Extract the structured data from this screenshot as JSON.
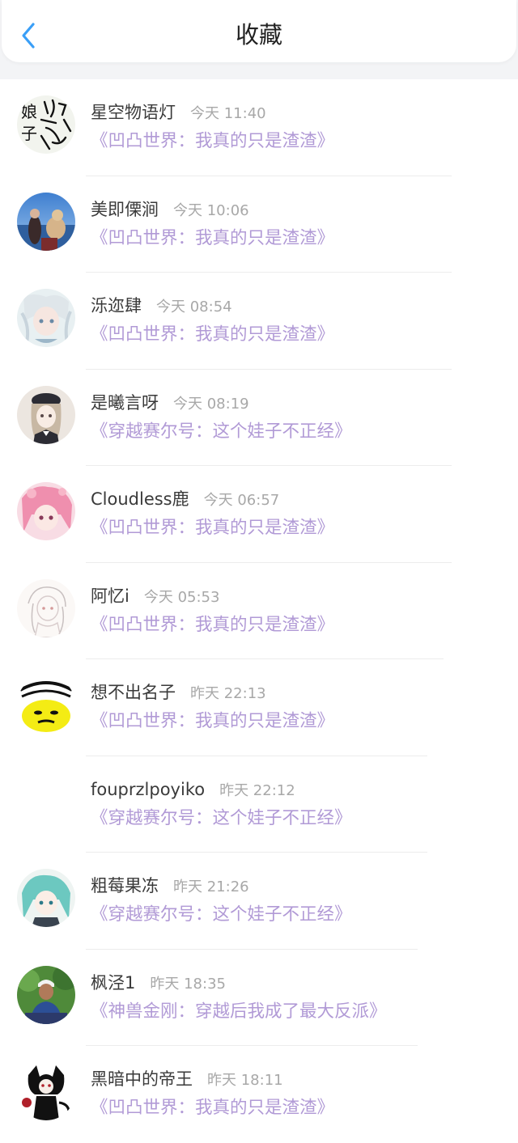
{
  "header": {
    "title": "收藏",
    "back_icon": "chevron-left-icon",
    "accent": "#3a9ff7"
  },
  "colors": {
    "book_title": "#b19ad6",
    "name": "#3a3a3a",
    "time": "#a8a8a8"
  },
  "items": [
    {
      "name": "星空物语灯",
      "time": "今天 11:40",
      "book": "《凹凸世界：我真的只是渣渣》",
      "avatar": "avatar-handwriting"
    },
    {
      "name": "美即傈涧",
      "time": "今天 10:06",
      "book": "《凹凸世界：我真的只是渣渣》",
      "avatar": "avatar-seaside-photo"
    },
    {
      "name": "泺迩肆",
      "time": "今天 08:54",
      "book": "《凹凸世界：我真的只是渣渣》",
      "avatar": "avatar-anime-white-hair"
    },
    {
      "name": "是曦言呀",
      "time": "今天 08:19",
      "book": "《穿越赛尔号：这个娃子不正经》",
      "avatar": "avatar-anime-beret"
    },
    {
      "name": "Cloudless鹿",
      "time": "今天 06:57",
      "book": "《凹凸世界：我真的只是渣渣》",
      "avatar": "avatar-anime-pink-hair"
    },
    {
      "name": "阿忆i",
      "time": "今天 05:53",
      "book": "《凹凸世界：我真的只是渣渣》",
      "avatar": "avatar-sketch"
    },
    {
      "name": "想不出名子",
      "time": "昨天 22:13",
      "book": "《凹凸世界：我真的只是渣渣》",
      "avatar": "avatar-meme-face"
    },
    {
      "name": "fouprzlpoyiko",
      "time": "昨天 22:12",
      "book": "《穿越赛尔号：这个娃子不正经》",
      "avatar": ""
    },
    {
      "name": "粗莓果冻",
      "time": "昨天 21:26",
      "book": "《穿越赛尔号：这个娃子不正经》",
      "avatar": "avatar-anime-teal-hair"
    },
    {
      "name": "枫泾1",
      "time": "昨天 18:35",
      "book": "《神兽金刚：穿越后我成了最大反派》",
      "avatar": "avatar-man-photo"
    },
    {
      "name": "黑暗中的帝王",
      "time": "昨天 18:11",
      "book": "《凹凸世界：我真的只是渣渣》",
      "avatar": "avatar-dark-character"
    }
  ]
}
